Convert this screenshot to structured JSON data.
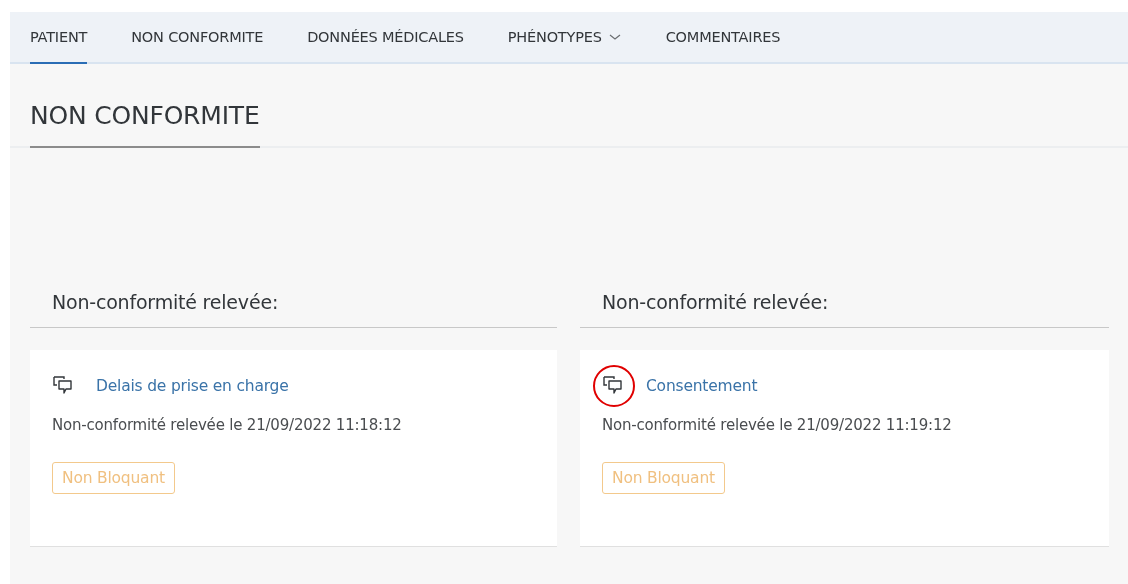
{
  "tabs": [
    {
      "label": "PATIENT",
      "selected": true,
      "dropdown": false
    },
    {
      "label": "NON CONFORMITE",
      "selected": false,
      "dropdown": false
    },
    {
      "label": "DONNÉES MÉDICALES",
      "selected": false,
      "dropdown": false
    },
    {
      "label": "PHÉNOTYPES",
      "selected": false,
      "dropdown": true
    },
    {
      "label": "COMMENTAIRES",
      "selected": false,
      "dropdown": false
    }
  ],
  "section_title": "NON CONFORMITE",
  "columns": [
    {
      "heading": "Non-conformité relevée:",
      "card": {
        "title": "Delais de prise en charge",
        "detail": "Non-conformité relevée le 21/09/2022 11:18:12",
        "status": "Non Bloquant",
        "highlighted": false
      }
    },
    {
      "heading": "Non-conformité relevée:",
      "card": {
        "title": "Consentement",
        "detail": "Non-conformité relevée le 21/09/2022 11:19:12",
        "status": "Non Bloquant",
        "highlighted": true
      }
    }
  ]
}
